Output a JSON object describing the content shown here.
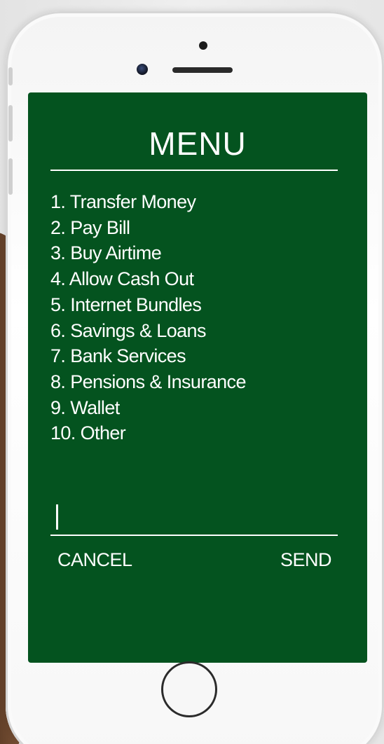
{
  "screen": {
    "title": "MENU",
    "background_color": "#04531f",
    "text_color": "#ffffff"
  },
  "menu": {
    "items": [
      {
        "label": "1. Transfer Money"
      },
      {
        "label": "2. Pay Bill"
      },
      {
        "label": "3. Buy Airtime"
      },
      {
        "label": "4. Allow Cash Out"
      },
      {
        "label": "5. Internet Bundles"
      },
      {
        "label": "6. Savings & Loans"
      },
      {
        "label": "7. Bank Services"
      },
      {
        "label": "8. Pensions & Insurance"
      },
      {
        "label": "9. Wallet"
      },
      {
        "label": "10. Other"
      }
    ]
  },
  "input": {
    "value": ""
  },
  "actions": {
    "cancel_label": "CANCEL",
    "send_label": "SEND"
  },
  "icons": {
    "camera": "camera-icon",
    "speaker": "speaker-grille-icon",
    "home": "home-button-icon"
  }
}
